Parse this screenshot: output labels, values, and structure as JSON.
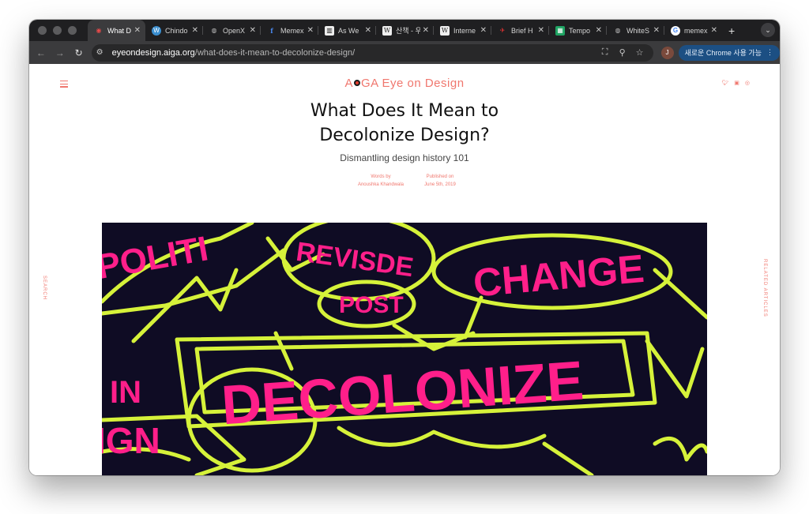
{
  "browser": {
    "tabs": [
      {
        "label": "What D",
        "active": true,
        "icon": "eye-icon"
      },
      {
        "label": "Chindo",
        "icon": "wordpress-icon"
      },
      {
        "label": "OpenX",
        "icon": "globe-icon"
      },
      {
        "label": "Memex",
        "icon": "facebook-icon"
      },
      {
        "label": "As We",
        "icon": "columns-icon"
      },
      {
        "label": "산책 - 우",
        "icon": "wikipedia-icon"
      },
      {
        "label": "Interne",
        "icon": "wikipedia-icon"
      },
      {
        "label": "Brief H",
        "icon": "plane-icon"
      },
      {
        "label": "Tempo",
        "icon": "sheets-icon"
      },
      {
        "label": "WhiteS",
        "icon": "globe-icon"
      },
      {
        "label": "memex",
        "icon": "google-icon"
      }
    ],
    "new_tab": "+",
    "url_host": "eyeondesign.aiga.org",
    "url_path": "/what-does-it-mean-to-decolonize-design/",
    "profile_initial": "J",
    "chrome_button": "새로운 Chrome 사용 가능",
    "colors": {
      "frame": "#1f1f21",
      "toolbar": "#3b3b3d",
      "accent": "#f0776e"
    }
  },
  "site": {
    "logo_left": "A",
    "logo_right": "GA Eye on Design",
    "social": [
      "twitter-icon",
      "facebook-icon",
      "instagram-icon"
    ],
    "search_label": "SEARCH",
    "related_label": "RELATED ARTICLES"
  },
  "article": {
    "title_line1": "What Does It Mean to",
    "title_line2": "Decolonize Design?",
    "subtitle": "Dismantling design history 101",
    "words_by_label": "Words by",
    "author": "Anoushka Khandwala",
    "published_label": "Published on",
    "date": "June 5th, 2019"
  },
  "hero": {
    "words": [
      "POLITI",
      "REVISDE",
      "POST",
      "CHANGE",
      "DECOLONIZE",
      "IN",
      "IGN"
    ],
    "colors": {
      "bg": "#0f0c24",
      "pink": "#ff1f8a",
      "lime": "#d6f23a"
    }
  }
}
